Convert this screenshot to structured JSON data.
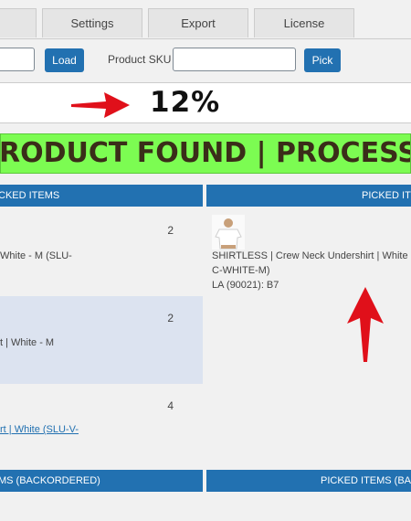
{
  "tabs": [
    "Settings",
    "Export",
    "License"
  ],
  "toolbar": {
    "load_label": "Load",
    "sku_label": "Product SKU",
    "pick_label": "Pick",
    "left_input_value": "",
    "sku_input_value": ""
  },
  "progress": {
    "percent_text": "12%"
  },
  "banner": {
    "text": "RODUCT FOUND | PROCESSING"
  },
  "left_column": {
    "header": "CKED ITEMS",
    "items": [
      {
        "qty": "2",
        "line1": "White - M (SLU-",
        "line2": ""
      },
      {
        "qty": "2",
        "line1": "t | White - M",
        "line2": ""
      },
      {
        "qty": "4",
        "line1": "rt | White (SLU-V-",
        "line2": ""
      }
    ],
    "footer_header": "MS (BACKORDERED)"
  },
  "right_column": {
    "header": "PICKED ITE",
    "item": {
      "line1": "SHIRTLESS | Crew Neck Undershirt | White",
      "line2": "C-WHITE-M)",
      "line3": "LA (90021): B7"
    },
    "footer_header": "PICKED ITEMS (BAC"
  },
  "colors": {
    "accent": "#2271b1",
    "banner_bg": "#7cfc52",
    "highlight_row": "#dce3f0",
    "arrow": "#e0101a"
  }
}
